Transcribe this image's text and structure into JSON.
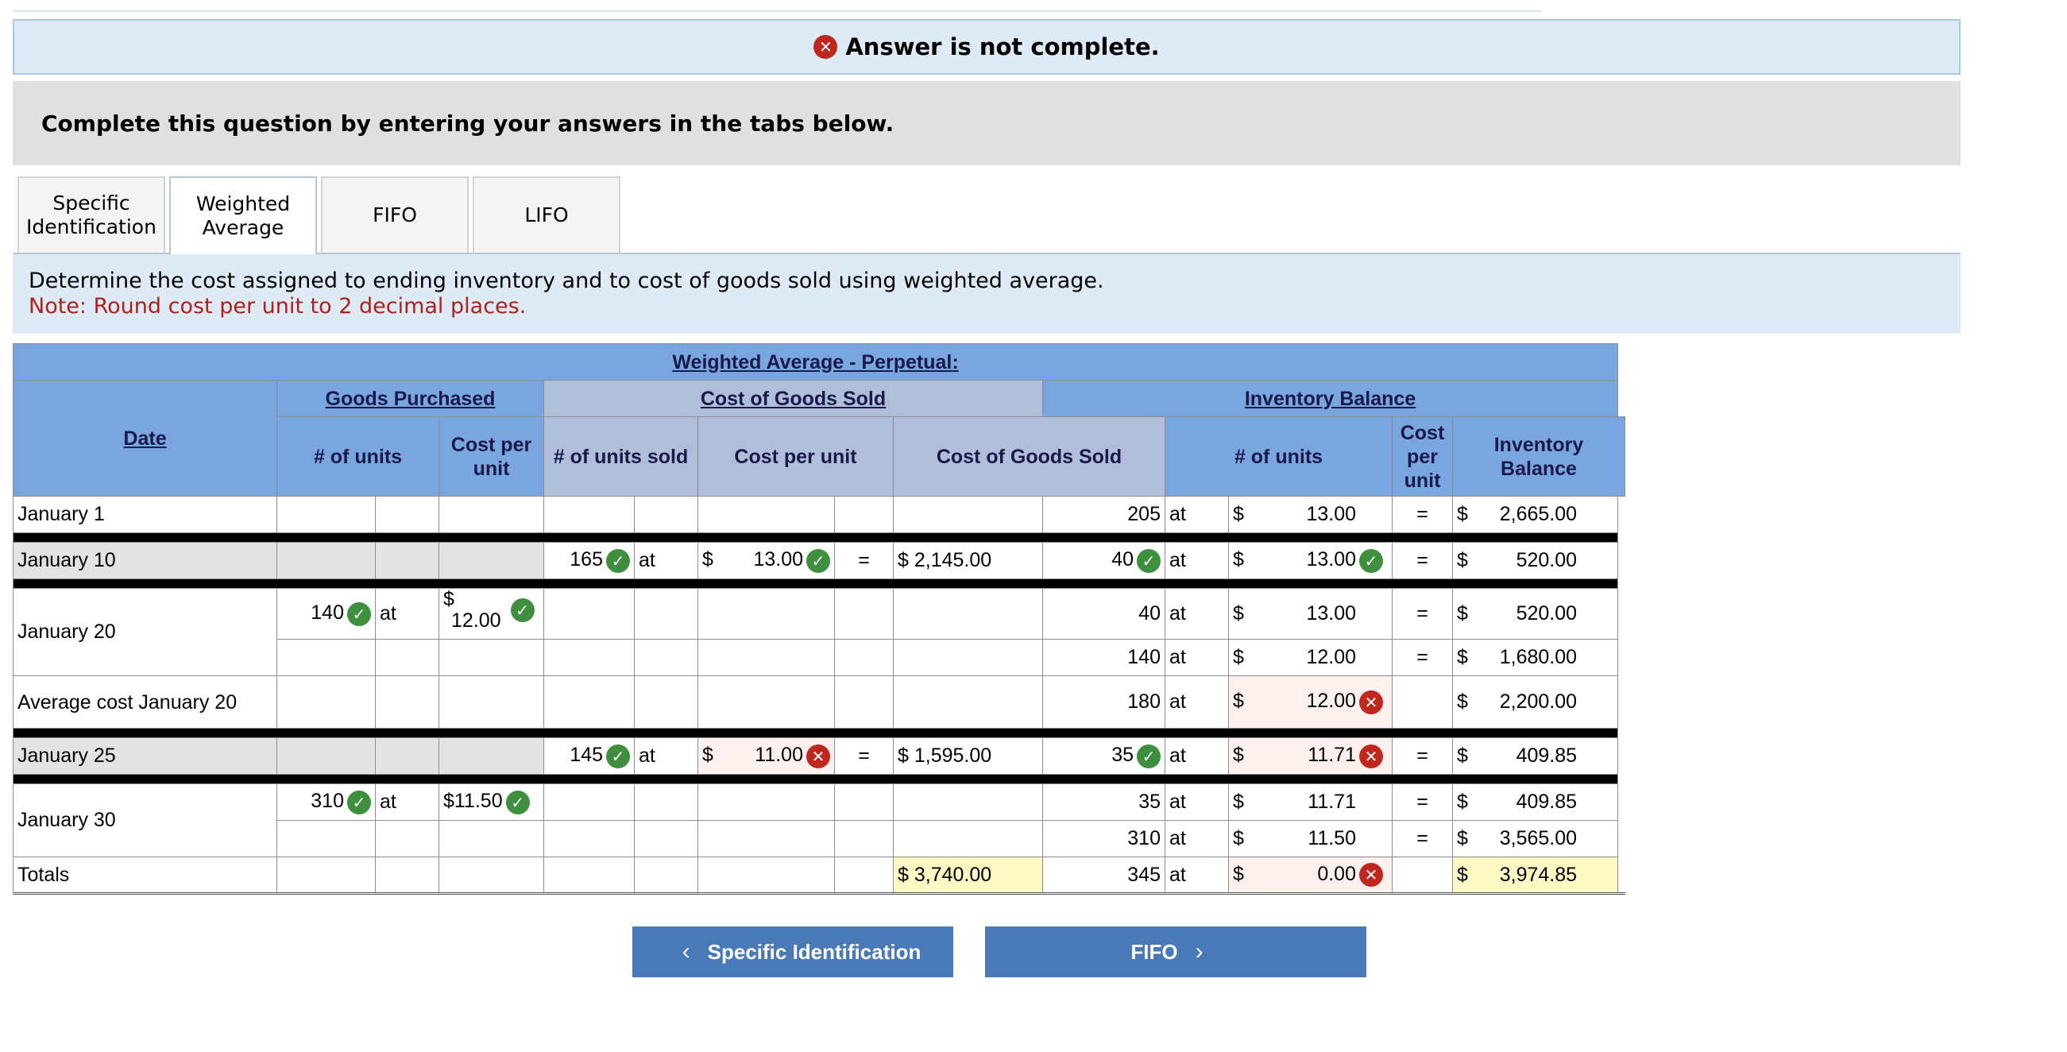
{
  "banner": {
    "text": "Answer is not complete."
  },
  "instruction": "Complete this question by entering your answers in the tabs below.",
  "tabs": [
    {
      "label": "Specific Identification",
      "active": false
    },
    {
      "label": "Weighted Average",
      "active": true
    },
    {
      "label": "FIFO",
      "active": false
    },
    {
      "label": "LIFO",
      "active": false
    }
  ],
  "task": {
    "text": "Determine the cost assigned to ending inventory and to cost of goods sold using weighted average.",
    "note": "Note: Round cost per unit to 2 decimal places."
  },
  "table": {
    "title": "Weighted Average - Perpetual:",
    "groups": {
      "purchased": "Goods Purchased",
      "cogs": "Cost of Goods Sold",
      "inventory": "Inventory Balance"
    },
    "headers": {
      "date": "Date",
      "p_units": "# of units",
      "p_cost": "Cost per unit",
      "s_units": "# of units sold",
      "s_cost": "Cost per unit",
      "s_total": "Cost of Goods Sold",
      "i_units": "# of units",
      "i_cost": "Cost per unit",
      "i_total": "Inventory Balance"
    },
    "at": "at",
    "dollar": "$",
    "eq": "=",
    "rows": {
      "jan1": {
        "date": "January 1",
        "i_units": "205",
        "i_cost": "13.00",
        "i_total": "2,665.00"
      },
      "jan10": {
        "date": "January 10",
        "s_units": "165",
        "s_cost": "13.00",
        "s_total": "2,145.00",
        "i_units": "40",
        "i_cost": "13.00",
        "i_total": "520.00"
      },
      "jan20": {
        "date": "January 20",
        "p_units": "140",
        "p_cost": "12.00",
        "i1_units": "40",
        "i1_cost": "13.00",
        "i1_total": "520.00",
        "i2_units": "140",
        "i2_cost": "12.00",
        "i2_total": "1,680.00"
      },
      "avg20": {
        "date": "Average cost January 20",
        "i_units": "180",
        "i_cost": "12.00",
        "i_total": "2,200.00"
      },
      "jan25": {
        "date": "January 25",
        "s_units": "145",
        "s_cost": "11.00",
        "s_total": "1,595.00",
        "i_units": "35",
        "i_cost": "11.71",
        "i_total": "409.85"
      },
      "jan30": {
        "date": "January 30",
        "p_units": "310",
        "p_cost": "$11.50",
        "i1_units": "35",
        "i1_cost": "11.71",
        "i1_total": "409.85",
        "i2_units": "310",
        "i2_cost": "11.50",
        "i2_total": "3,565.00"
      },
      "totals": {
        "date": "Totals",
        "s_total": "3,740.00",
        "i_units": "345",
        "i_cost": "0.00",
        "i_total": "3,974.85"
      }
    }
  },
  "nav": {
    "prev": "Specific Identification",
    "next": "FIFO"
  },
  "colors": {
    "header_blue": "#7aa6e0",
    "header_grey": "#b0bed9",
    "correct": "#3e8f3e",
    "incorrect": "#c0271f",
    "button": "#4a79b8",
    "note": "#b0201a"
  }
}
